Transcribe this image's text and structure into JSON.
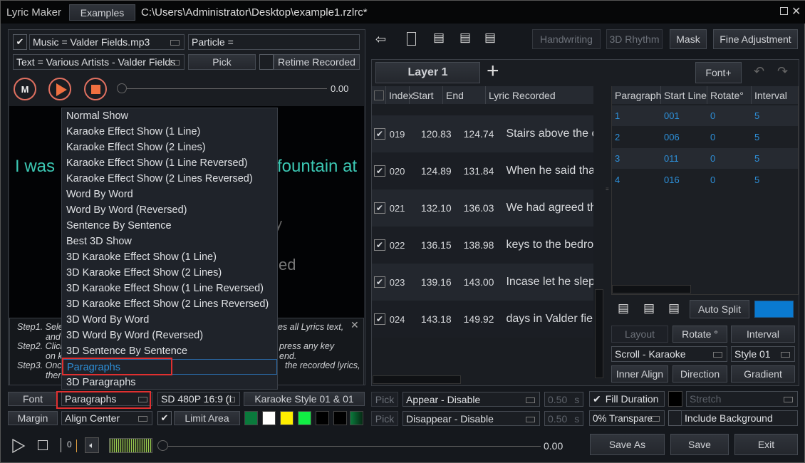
{
  "title_bar": {
    "app_name": "Lyric Maker",
    "examples_label": "Examples",
    "file_path": "C:\\Users\\Administrator\\Desktop\\example1.rzlrc*"
  },
  "left": {
    "music_field": "Music = Valder Fields.mp3",
    "particle_field": "Particle =",
    "text_field": "Text = Various Artists - Valder Fields",
    "pick_label": "Pick",
    "retime_label": "Retime Recorded",
    "time": "0.00",
    "preview": {
      "line1_left": "I was",
      "line1_right": "fountain at",
      "line2_frag": "y",
      "line3_frag": "ed",
      "color": "#3cc8b4"
    },
    "steps": [
      {
        "label": "Step1. Sele",
        "cont": "and",
        "right": "es all Lyrics text,"
      },
      {
        "label": "Step2. Click",
        "cont": "on k",
        "right": "press any key",
        "right2": "end."
      },
      {
        "label": "Step3. Once",
        "cont": "then",
        "right": "the recorded lyrics,"
      }
    ],
    "menu_items": [
      "Normal Show",
      "Karaoke Effect Show (1 Line)",
      "Karaoke Effect Show (2 Lines)",
      "Karaoke Effect Show (1 Line Reversed)",
      "Karaoke Effect Show (2 Lines Reversed)",
      "Word By Word",
      "Word By Word (Reversed)",
      "Sentence By Sentence",
      "Best 3D Show",
      "3D Karaoke Effect Show (1 Line)",
      "3D Karaoke Effect Show (2 Lines)",
      "3D Karaoke Effect Show (1 Line Reversed)",
      "3D Karaoke Effect Show (2 Lines Reversed)",
      "3D Word By Word",
      "3D Word By Word (Reversed)",
      "3D Sentence By Sentence",
      "Paragraphs",
      "3D Paragraphs"
    ],
    "menu_selected": "Paragraphs",
    "font_label": "Font",
    "show_mode": "Paragraphs",
    "resolution": "SD 480P 16:9 (I",
    "karaoke_style": "Karaoke Style 01 & 01",
    "margin_label": "Margin",
    "align": "Align Center",
    "limit_area": "Limit Area",
    "swatches": [
      "#0a7a3c",
      "#ffffff",
      "#ffee00",
      "#11ee44",
      "#000000",
      "#000000"
    ],
    "player": {
      "counter": "0",
      "time": "0.00"
    }
  },
  "right": {
    "handwriting": "Handwriting",
    "rhythm": "3D Rhythm",
    "mask": "Mask",
    "fine": "Fine Adjustment",
    "layer_tab": "Layer 1",
    "font_plus": "Font+",
    "columns": [
      "Index",
      "Start",
      "End",
      "Lyric Recorded"
    ],
    "rows": [
      {
        "index": "019",
        "start": "120.83",
        "end": "124.74",
        "lyric": "Stairs above the c"
      },
      {
        "index": "020",
        "start": "124.89",
        "end": "131.84",
        "lyric": "When he said tha"
      },
      {
        "index": "021",
        "start": "132.10",
        "end": "136.03",
        "lyric": "We had agreed th"
      },
      {
        "index": "022",
        "start": "136.15",
        "end": "138.98",
        "lyric": "keys to the bedroo"
      },
      {
        "index": "023",
        "start": "139.16",
        "end": "143.00",
        "lyric": "Incase let he slep"
      },
      {
        "index": "024",
        "start": "143.18",
        "end": "149.92",
        "lyric": "days in Valder fie"
      }
    ],
    "para_columns": [
      "Paragraph",
      "Start Line",
      "Rotate°",
      "Interval"
    ],
    "para_rows": [
      {
        "p": "1",
        "s": "001",
        "r": "0",
        "i": "5"
      },
      {
        "p": "2",
        "s": "006",
        "r": "0",
        "i": "5"
      },
      {
        "p": "3",
        "s": "011",
        "r": "0",
        "i": "5"
      },
      {
        "p": "4",
        "s": "016",
        "r": "0",
        "i": "5"
      }
    ],
    "auto_split": "Auto Split",
    "accent": "#0a7ad0",
    "layout": "Layout",
    "rotate": "Rotate °",
    "interval": "Interval",
    "scroll": "Scroll - Karaoke",
    "style": "Style 01",
    "inner_align": "Inner Align",
    "direction": "Direction",
    "gradient": "Gradient",
    "pick": "Pick",
    "appear": "Appear - Disable",
    "disappear": "Disappear - Disable",
    "dur1": "0.50",
    "dur2": "0.50",
    "unit": "s",
    "fill_duration": "Fill Duration",
    "stretch": "Stretch",
    "transparency": "0% Transpare",
    "include_bg": "Include Background",
    "save_as": "Save As",
    "save": "Save",
    "exit": "Exit"
  }
}
